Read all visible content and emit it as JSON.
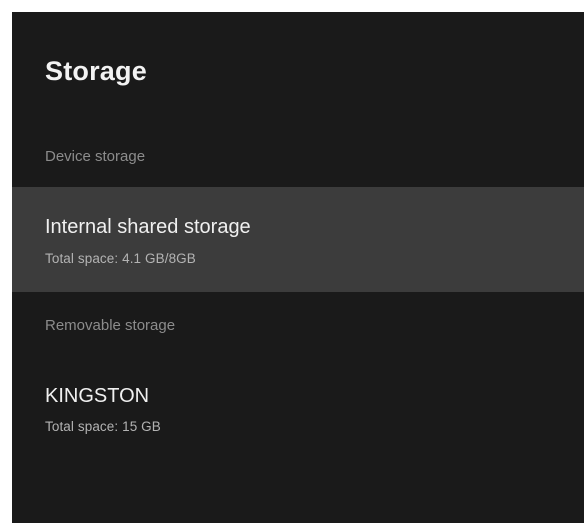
{
  "page": {
    "title": "Storage"
  },
  "sections": [
    {
      "header": "Device storage",
      "items": [
        {
          "title": "Internal shared storage",
          "subtitle": "Total space: 4.1 GB/8GB",
          "focused": true
        }
      ]
    },
    {
      "header": "Removable storage",
      "items": [
        {
          "title": "KINGSTON",
          "subtitle": "Total space: 15 GB",
          "focused": false
        }
      ]
    }
  ],
  "colors": {
    "background": "#1a1a1a",
    "focused_row": "#3c3c3c",
    "section_header_text": "#8c8c8c",
    "subtitle_text": "#b3b3b3"
  }
}
